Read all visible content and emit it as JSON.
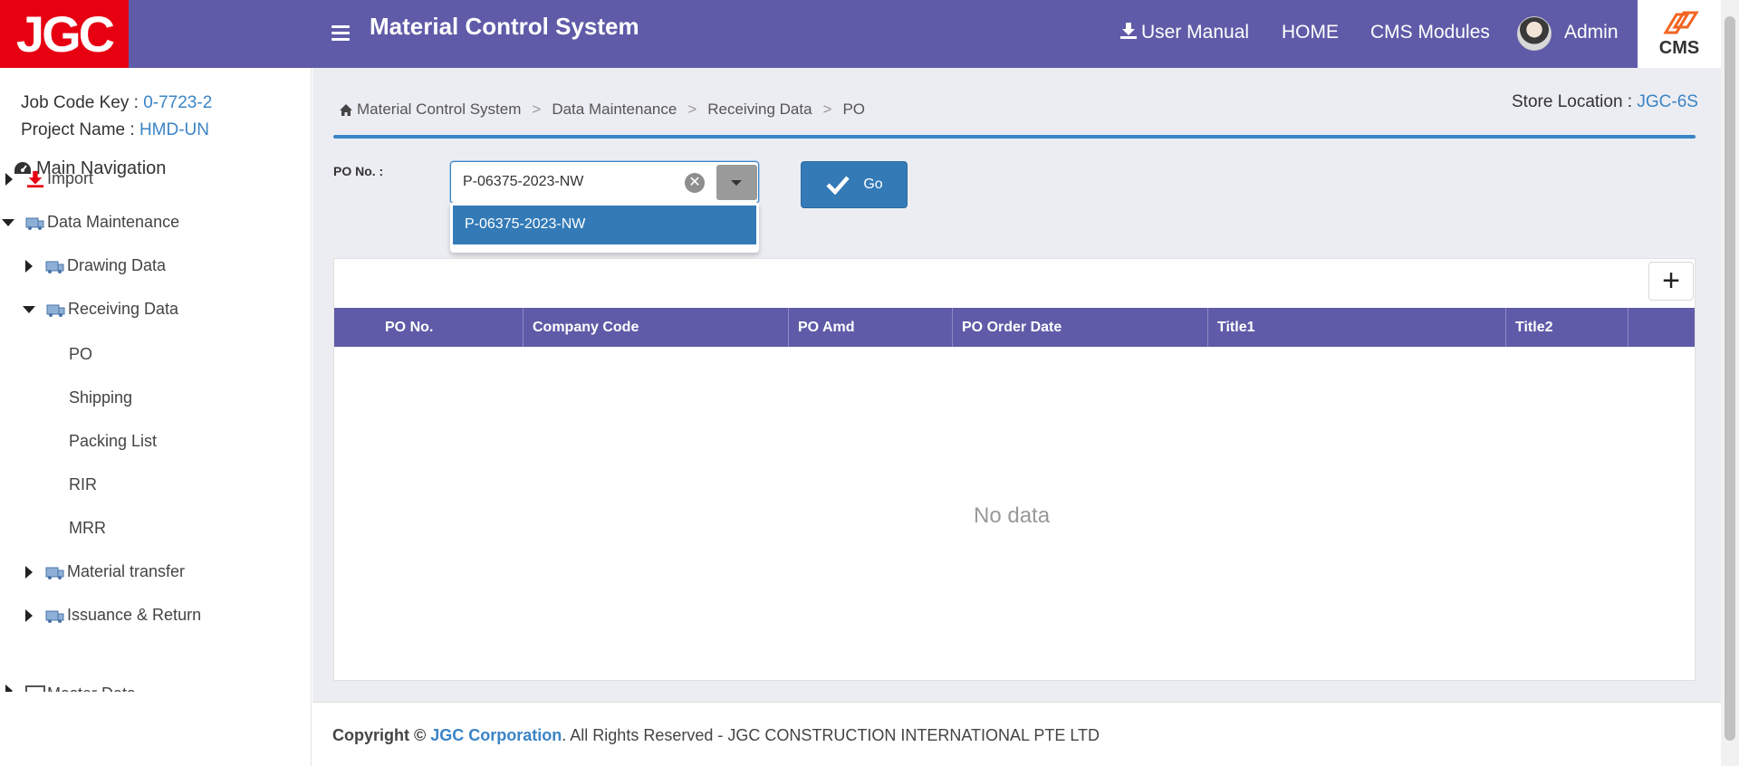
{
  "header": {
    "logo_text": "JGC",
    "app_title": "Material Control System",
    "user_manual": "User Manual",
    "home": "HOME",
    "cms_modules": "CMS Modules",
    "user_name": "Admin",
    "cms_logo_text": "CMS",
    "bg_color": "#5f5ba8"
  },
  "sidebar": {
    "job_code_label": "Job Code Key : ",
    "job_code_value": "0-7723-2",
    "project_label": "Project Name : ",
    "project_value": "HMD-UN",
    "main_nav": "Main Navigation",
    "items": [
      {
        "label": "Import",
        "state": "collapsed",
        "icon": "download-icon"
      },
      {
        "label": "Data Maintenance",
        "state": "expanded",
        "icon": "truck-icon"
      },
      {
        "label": "Drawing Data",
        "state": "collapsed",
        "icon": "truck-icon"
      },
      {
        "label": "Receiving Data",
        "state": "expanded",
        "icon": "truck-icon"
      },
      {
        "label": "PO"
      },
      {
        "label": "Shipping"
      },
      {
        "label": "Packing List"
      },
      {
        "label": "RIR"
      },
      {
        "label": "MRR"
      },
      {
        "label": "Material transfer",
        "state": "collapsed",
        "icon": "truck-icon"
      },
      {
        "label": "Issuance & Return",
        "state": "collapsed",
        "icon": "truck-icon"
      },
      {
        "label": "Master Data",
        "state": "collapsed",
        "icon": "table-icon"
      }
    ]
  },
  "breadcrumb": [
    "Material Control System",
    "Data Maintenance",
    "Receiving Data",
    "PO"
  ],
  "store_location": {
    "label": "Store Location : ",
    "value": "JGC-6S"
  },
  "form": {
    "po_label": "PO No. :",
    "po_value": "P-06375-2023-NW",
    "dropdown_options": [
      "P-06375-2023-NW"
    ],
    "go_label": "Go"
  },
  "grid": {
    "columns": [
      "PO No.",
      "Company Code",
      "PO Amd",
      "PO Order Date",
      "Title1",
      "Title2",
      ""
    ],
    "empty_text": "No data",
    "add_label": "+"
  },
  "footer": {
    "copyright": "Copyright © ",
    "corp": "JGC Corporation",
    "rest": ". All Rights Reserved - JGC CONSTRUCTION INTERNATIONAL PTE LTD"
  }
}
